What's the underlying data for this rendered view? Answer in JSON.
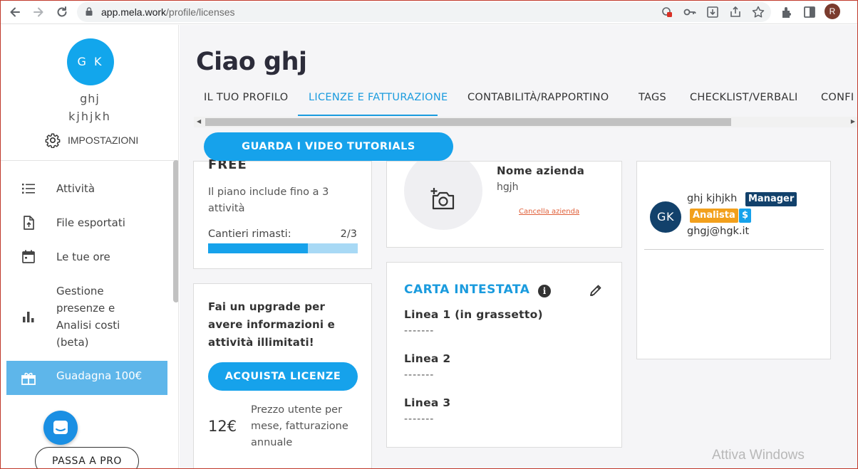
{
  "browser": {
    "url_host": "app.mela.work",
    "url_path": "/profile/licenses",
    "profile_initial": "R"
  },
  "sidebar": {
    "avatar_initials": "G K",
    "first_name": "ghj",
    "last_name": "kjhjkh",
    "settings_label": "IMPOSTAZIONI",
    "items": [
      {
        "label": "Attività",
        "icon": "list-icon"
      },
      {
        "label": "File esportati",
        "icon": "file-upload-icon"
      },
      {
        "label": "Le tue ore",
        "icon": "calendar-icon"
      },
      {
        "label": "Gestione presenze e Analisi costi (beta)",
        "label_lines": [
          "Gestione",
          "presenze e",
          "Analisi costi",
          "(beta)"
        ],
        "icon": "bar-chart-icon"
      },
      {
        "label": "Guadagna 100€",
        "icon": "gift-icon",
        "active": true
      }
    ],
    "pro_button": "PASSA A PRO"
  },
  "main": {
    "greeting": "Ciao ghj",
    "tabs": [
      {
        "label": "IL TUO PROFILO"
      },
      {
        "label": "LICENZE E FATTURAZIONE",
        "active": true
      },
      {
        "label": "CONTABILITÀ/RAPPORTINO"
      },
      {
        "label": "TAGS"
      },
      {
        "label": "CHECKLIST/VERBALI"
      },
      {
        "label": "CONFI"
      }
    ],
    "video_button": "GUARDA I VIDEO TUTORIALS",
    "plan": {
      "name": "FREE",
      "description": "Il piano include fino a 3 attività",
      "sites_label": "Cantieri rimasti:",
      "sites_value": "2/3",
      "sites_remaining_fraction": 0.667
    },
    "upgrade": {
      "text": "Fai un upgrade per avere informazioni e attività illimitati!",
      "buy_button": "ACQUISTA LICENZE",
      "price": "12€",
      "price_description": "Prezzo utente per mese, fatturazione annuale"
    },
    "company": {
      "label": "Nome azienda",
      "value": "hgjh",
      "delete_link": "Cancella azienda"
    },
    "letterhead": {
      "title": "CARTA INTESTATA",
      "lines": [
        {
          "label": "Linea 1 (in grassetto)",
          "value": "-------"
        },
        {
          "label": "Linea 2",
          "value": "-------"
        },
        {
          "label": "Linea 3",
          "value": "-------"
        }
      ]
    },
    "user": {
      "initials": "GK",
      "name": "ghj kjhjkh",
      "role_badge": "Manager",
      "analyst_badge": "Analista",
      "currency_badge": "$",
      "email": "ghgj@hgk.it"
    }
  },
  "watermark": "Attiva Windows",
  "colors": {
    "accent": "#16a2eb",
    "sidebar_active": "#5eb6ea",
    "manager_badge": "#12416b",
    "analista_badge": "#f2a01c",
    "delete_link": "#e0603a"
  }
}
